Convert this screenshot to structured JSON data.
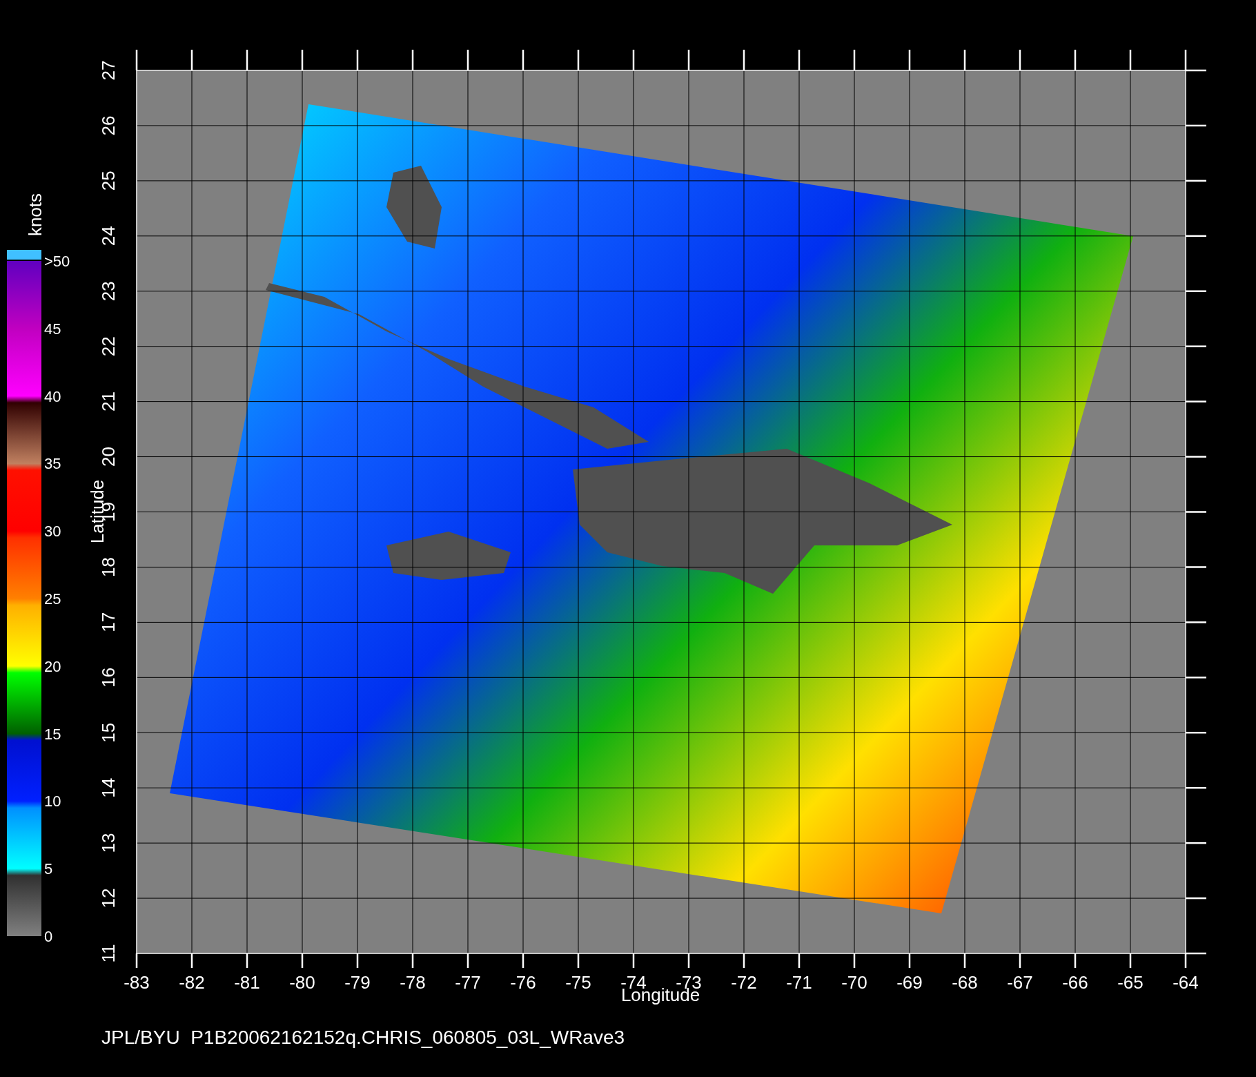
{
  "plot": {
    "x_axis": {
      "label": "Longitude",
      "ticks": [
        "-83",
        "-82",
        "-81",
        "-80",
        "-79",
        "-78",
        "-77",
        "-76",
        "-75",
        "-74",
        "-73",
        "-72",
        "-71",
        "-70",
        "-69",
        "-68",
        "-67",
        "-66",
        "-65",
        "-64"
      ]
    },
    "y_axis": {
      "label": "Latitude",
      "ticks": [
        "27",
        "26",
        "25",
        "24",
        "23",
        "22",
        "21",
        "20",
        "19",
        "18",
        "17",
        "16",
        "15",
        "14",
        "13",
        "12",
        "11"
      ]
    }
  },
  "colorbar": {
    "unit": "knots",
    "labels": [
      ">50",
      "45",
      "40",
      "35",
      "30",
      "25",
      "20",
      "15",
      "10",
      "5",
      "0"
    ]
  },
  "footer": "JPL/BYU  P1B20062162152q.CHRIS_060805_03L_WRave3"
}
